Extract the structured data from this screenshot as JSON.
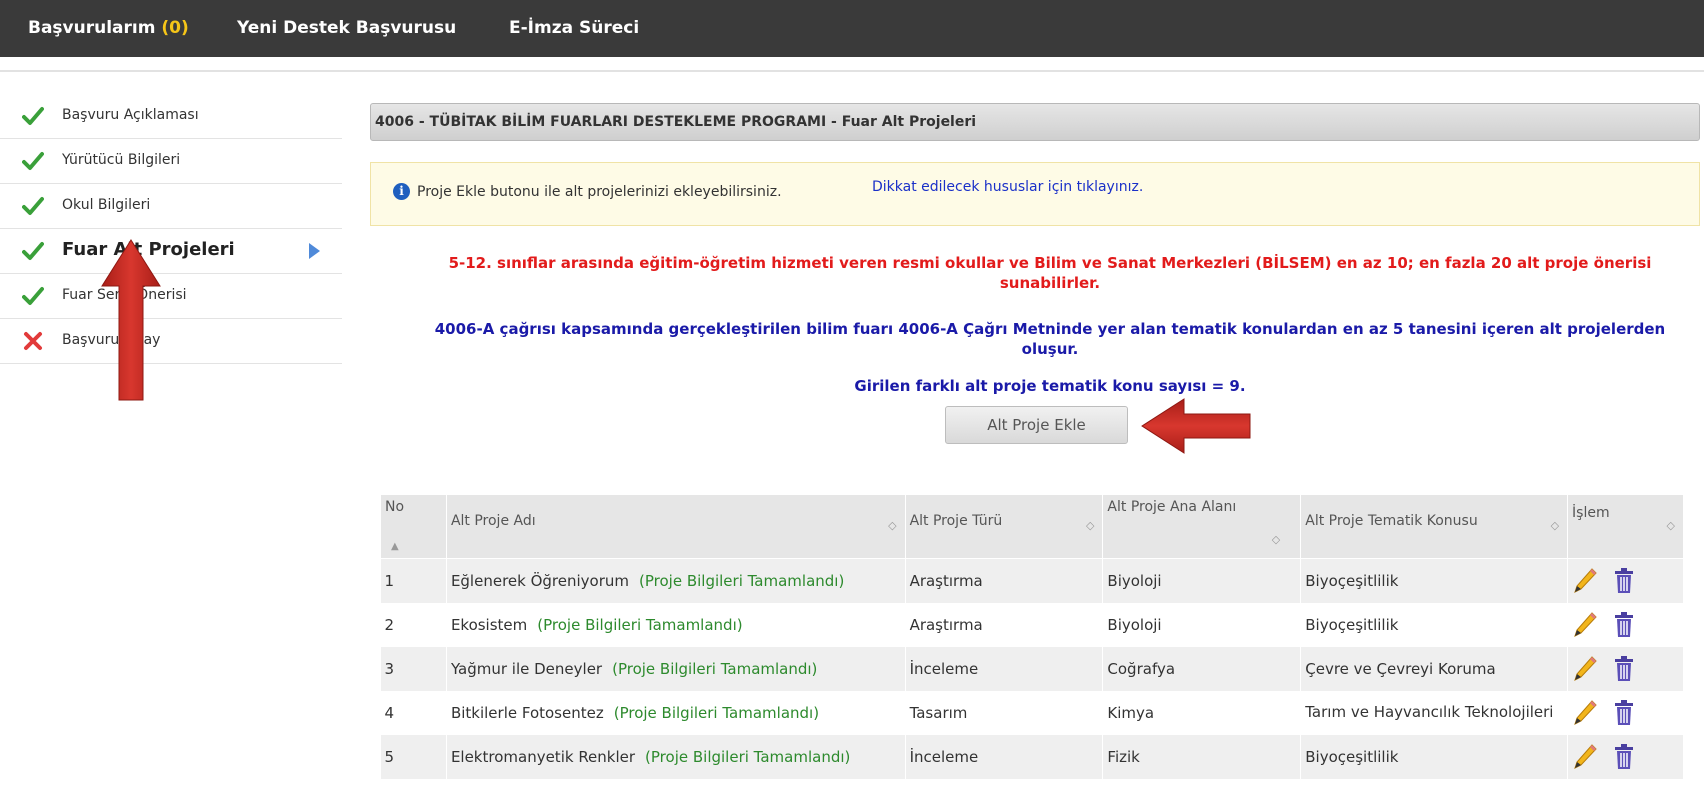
{
  "topnav": {
    "applications_label": "Başvurularım",
    "applications_count": "(0)",
    "new_support_label": "Yeni Destek Başvurusu",
    "esign_label": "E-İmza Süreci"
  },
  "sidebar": {
    "items": [
      {
        "label": "Başvuru Açıklaması",
        "status": "done"
      },
      {
        "label": "Yürütücü Bilgileri",
        "status": "done"
      },
      {
        "label": "Okul Bilgileri",
        "status": "done"
      },
      {
        "label": "Fuar Alt Projeleri",
        "status": "done",
        "active": true
      },
      {
        "label": "Fuar Sergi Önerisi",
        "status": "done"
      },
      {
        "label": "Başvuru Onay",
        "status": "error"
      }
    ]
  },
  "main": {
    "panel_title": "4006 - TÜBİTAK BİLİM FUARLARI DESTEKLEME PROGRAMI - Fuar Alt Projeleri",
    "info_text": "Proje Ekle butonu ile alt projelerinizi ekleyebilirsiniz.",
    "info_link": "Dikkat edilecek hususlar için tıklayınız.",
    "red_msg_line1": "5-12. sınıflar arasında eğitim-öğretim hizmeti veren resmi okullar ve Bilim ve Sanat Merkezleri (BİLSEM) en az 10; en fazla 20 alt proje önerisi",
    "red_msg_line2": "sunabilirler.",
    "blue_msg_line1": "4006-A çağrısı kapsamında gerçekleştirilen bilim fuarı 4006-A Çağrı Metninde yer alan tematik konulardan en az 5 tanesini içeren alt projelerden",
    "blue_msg_line2": "oluşur.",
    "theme_count_text": "Girilen farklı alt proje tematik konu sayısı = 9.",
    "add_button": "Alt Proje Ekle"
  },
  "table": {
    "headers": [
      "No",
      "Alt Proje Adı",
      "Alt Proje Türü",
      "Alt Proje Ana Alanı",
      "Alt Proje Tematik Konusu",
      "İşlem"
    ],
    "rows": [
      {
        "no": "1",
        "name": "Eğlenerek Öğreniyorum",
        "status": "(Proje Bilgileri Tamamlandı)",
        "type": "Araştırma",
        "field": "Biyoloji",
        "theme": "Biyoçeşitlilik"
      },
      {
        "no": "2",
        "name": "Ekosistem",
        "status": "(Proje Bilgileri Tamamlandı)",
        "type": "Araştırma",
        "field": "Biyoloji",
        "theme": "Biyoçeşitlilik"
      },
      {
        "no": "3",
        "name": "Yağmur ile Deneyler",
        "status": "(Proje Bilgileri Tamamlandı)",
        "type": "İnceleme",
        "field": "Coğrafya",
        "theme": "Çevre ve Çevreyi Koruma"
      },
      {
        "no": "4",
        "name": "Bitkilerle Fotosentez",
        "status": "(Proje Bilgileri Tamamlandı)",
        "type": "Tasarım",
        "field": "Kimya",
        "theme": "Tarım ve Hayvancılık Teknolojileri"
      },
      {
        "no": "5",
        "name": "Elektromanyetik Renkler",
        "status": "(Proje Bilgileri Tamamlandı)",
        "type": "İnceleme",
        "field": "Fizik",
        "theme": "Biyoçeşitlilik"
      }
    ]
  },
  "icons": {
    "done": "check-icon",
    "error": "x-icon",
    "edit": "pencil-icon",
    "delete": "trash-icon",
    "info": "info-icon"
  },
  "colors": {
    "topnav_bg": "#3a3a3a",
    "count_accent": "#f5c518",
    "red_msg": "#e21b1b",
    "blue_msg": "#1a1aa8",
    "status_green": "#2d8a2d",
    "callout_arrow": "#c92d25"
  }
}
